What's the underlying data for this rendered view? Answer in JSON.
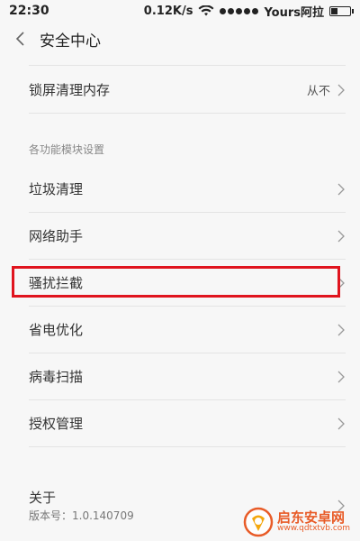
{
  "status_bar": {
    "time": "22:30",
    "net_speed": "0.12K/s",
    "carrier": "Yours阿拉"
  },
  "header": {
    "title": "安全中心"
  },
  "rows_top": [
    {
      "label": "锁屏清理内存",
      "value": "从不"
    }
  ],
  "section": {
    "title": "各功能模块设置",
    "items": [
      {
        "label": "垃圾清理"
      },
      {
        "label": "网络助手"
      },
      {
        "label": "骚扰拦截"
      },
      {
        "label": "省电优化"
      },
      {
        "label": "病毒扫描"
      },
      {
        "label": "授权管理"
      }
    ]
  },
  "about": {
    "label": "关于",
    "version": "版本号：1.0.140709"
  },
  "watermark": {
    "name": "启东安卓网",
    "url": "www.qdtxtvb.com"
  },
  "colors": {
    "highlight": "#e0141e",
    "watermark": "#e8531c"
  }
}
